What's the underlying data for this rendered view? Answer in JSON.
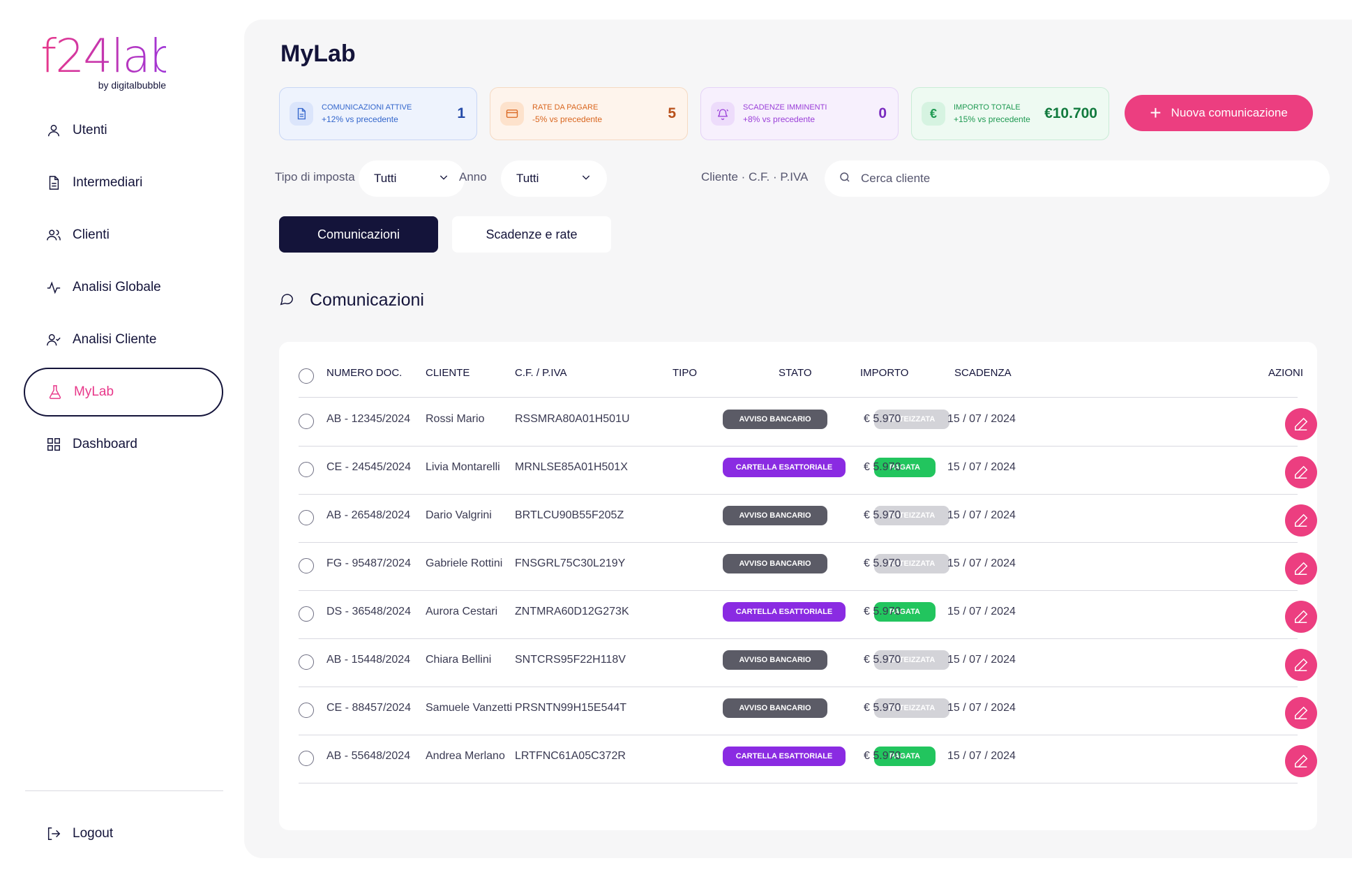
{
  "brand": {
    "logo_text": "f24lab",
    "logo_sub": "by digitalbubble"
  },
  "sidebar": {
    "items": [
      {
        "label": "Utenti",
        "icon": "user-icon"
      },
      {
        "label": "Intermediari",
        "icon": "document-icon"
      },
      {
        "label": "Clienti",
        "icon": "users-icon"
      },
      {
        "label": "Analisi Globale",
        "icon": "activity-icon"
      },
      {
        "label": "Analisi Cliente",
        "icon": "user-check-icon"
      },
      {
        "label": "MyLab",
        "icon": "flask-icon",
        "active": true
      },
      {
        "label": "Dashboard",
        "icon": "grid-icon"
      }
    ],
    "logout_label": "Logout"
  },
  "page": {
    "title": "MyLab"
  },
  "kpis": [
    {
      "label": "Comunicazioni attive",
      "trend": "+12% vs precedente",
      "value": "1",
      "icon": "document-icon",
      "color": "#3366cc"
    },
    {
      "label": "Rate da pagare",
      "trend": "-5% vs precedente",
      "value": "5",
      "icon": "credit-card-icon",
      "color": "#d9661f"
    },
    {
      "label": "Scadenze imminenti",
      "trend": "+8% vs precedente",
      "value": "0",
      "icon": "bell-icon",
      "color": "#9a3ed8"
    },
    {
      "label": "Importo totale",
      "trend": "+15% vs precedente",
      "value": "€10.700",
      "icon": "euro-icon",
      "color": "#1f9a52"
    }
  ],
  "actions": {
    "new_label": "Nuova comunicazione",
    "accent": "#ec3e80"
  },
  "filters": {
    "tipo_label": "Tipo di imposta",
    "tipo_value": "Tutti",
    "anno_label": "Anno",
    "anno_value": "Tutti",
    "cliente_label": "Cliente · C.F. · P.IVA",
    "search_placeholder": "Cerca cliente"
  },
  "tabs": [
    {
      "label": "Comunicazioni",
      "active": true
    },
    {
      "label": "Scadenze e rate",
      "active": false
    }
  ],
  "section": {
    "title": "Comunicazioni",
    "icon": "chat-bubble-icon"
  },
  "table": {
    "headers": [
      "Numero doc.",
      "Cliente",
      "C.F. / P.IVA",
      "Tipo",
      "Stato",
      "Importo",
      "Scadenza",
      "Azioni"
    ],
    "rows": [
      {
        "numero": "AB - 12345/2024",
        "cliente": "Rossi Mario",
        "cf": "RSSMRA80A01H501U",
        "tipo": "Avviso bancario",
        "tipo_kind": "avviso",
        "stato": "Rateizzata",
        "stato_kind": "rateizzata",
        "importo": "€ 5.970",
        "scadenza": "15 / 07 / 2024"
      },
      {
        "numero": "CE - 24545/2024",
        "cliente": "Livia Montarelli",
        "cf": "MRNLSE85A01H501X",
        "tipo": "Cartella esattoriale",
        "tipo_kind": "cartella",
        "stato": "Pagata",
        "stato_kind": "pagata",
        "importo": "€ 5.970",
        "scadenza": "15 / 07 / 2024"
      },
      {
        "numero": "AB - 26548/2024",
        "cliente": "Dario Valgrini",
        "cf": "BRTLCU90B55F205Z",
        "tipo": "Avviso bancario",
        "tipo_kind": "avviso",
        "stato": "Rateizzata",
        "stato_kind": "rateizzata",
        "importo": "€ 5.970",
        "scadenza": "15 / 07 / 2024"
      },
      {
        "numero": "FG - 95487/2024",
        "cliente": "Gabriele Rottini",
        "cf": "FNSGRL75C30L219Y",
        "tipo": "Avviso bancario",
        "tipo_kind": "avviso",
        "stato": "Rateizzata",
        "stato_kind": "rateizzata",
        "importo": "€ 5.970",
        "scadenza": "15 / 07 / 2024"
      },
      {
        "numero": "DS - 36548/2024",
        "cliente": "Aurora Cestari",
        "cf": "ZNTMRA60D12G273K",
        "tipo": "Cartella esattoriale",
        "tipo_kind": "cartella",
        "stato": "Pagata",
        "stato_kind": "pagata",
        "importo": "€ 5.970",
        "scadenza": "15 / 07 / 2024"
      },
      {
        "numero": "AB - 15448/2024",
        "cliente": "Chiara Bellini",
        "cf": "SNTCRS95F22H118V",
        "tipo": "Avviso bancario",
        "tipo_kind": "avviso",
        "stato": "Rateizzata",
        "stato_kind": "rateizzata",
        "importo": "€ 5.970",
        "scadenza": "15 / 07 / 2024"
      },
      {
        "numero": "CE - 88457/2024",
        "cliente": "Samuele Vanzetti",
        "cf": "PRSNTN99H15E544T",
        "tipo": "Avviso bancario",
        "tipo_kind": "avviso",
        "stato": "Rateizzata",
        "stato_kind": "rateizzata",
        "importo": "€ 5.970",
        "scadenza": "15 / 07 / 2024"
      },
      {
        "numero": "AB - 55648/2024",
        "cliente": "Andrea Merlano",
        "cf": "LRTFNC61A05C372R",
        "tipo": "Cartella esattoriale",
        "tipo_kind": "cartella",
        "stato": "Pagata",
        "stato_kind": "pagata",
        "importo": "€ 5.970",
        "scadenza": "15 / 07 / 2024"
      }
    ]
  }
}
